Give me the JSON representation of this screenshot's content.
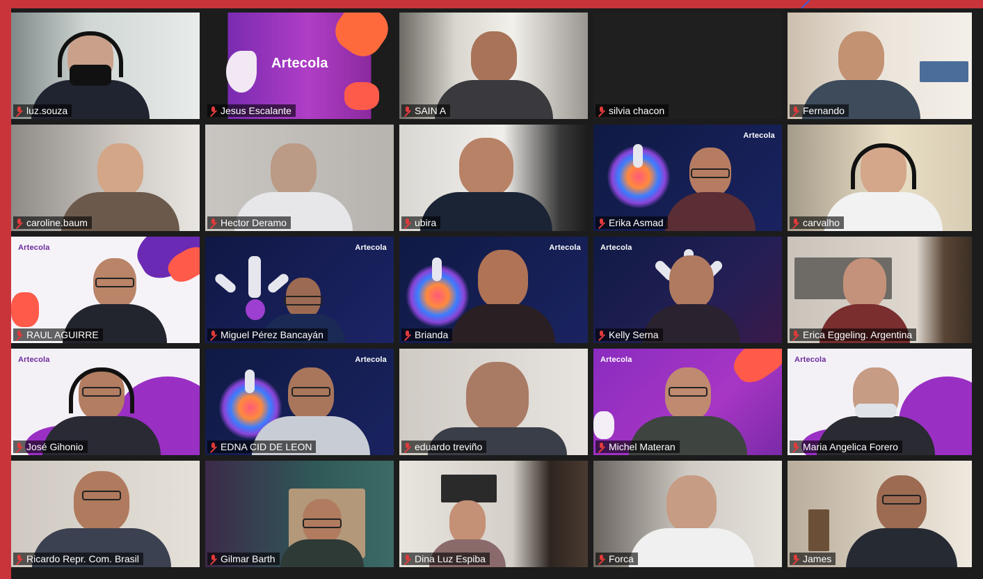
{
  "brand": "Artecola",
  "participants": [
    {
      "name": "luz.souza"
    },
    {
      "name": "Jesus Escalante"
    },
    {
      "name": "SAIN A"
    },
    {
      "name": "silvia chacon"
    },
    {
      "name": "Fernando"
    },
    {
      "name": "caroline.baum"
    },
    {
      "name": "Hector Deramo"
    },
    {
      "name": "ubira"
    },
    {
      "name": "Erika Asmad"
    },
    {
      "name": "carvalho"
    },
    {
      "name": "RAUL AGUIRRE"
    },
    {
      "name": "Miguel Pérez Bancayán"
    },
    {
      "name": "Brianda"
    },
    {
      "name": "Kelly Serna"
    },
    {
      "name": "Erica Eggeling. Argentina"
    },
    {
      "name": "José Gihonio"
    },
    {
      "name": "EDNA CID DE LEON"
    },
    {
      "name": "eduardo treviño"
    },
    {
      "name": "Michel Materan"
    },
    {
      "name": "Maria Angelica Forero"
    },
    {
      "name": "Ricardo Repr. Com. Brasil"
    },
    {
      "name": "Gilmar Barth"
    },
    {
      "name": "Dina Luz Espiba"
    },
    {
      "name": "Forca"
    },
    {
      "name": "James"
    }
  ]
}
